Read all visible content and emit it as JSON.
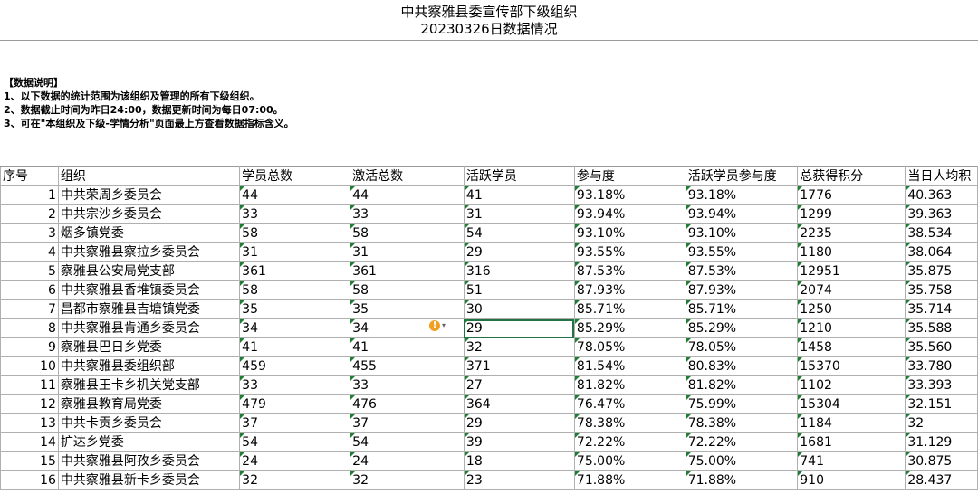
{
  "header": {
    "title": "中共察雅县委宣传部下级组织",
    "subtitle": "20230326日数据情况"
  },
  "notes": {
    "heading": "【数据说明】",
    "lines": [
      "1、以下数据的统计范围为该组织及管理的所有下级组织。",
      "2、数据截止时间为昨日24:00，数据更新时间为每日07:00。",
      "3、可在\"本组织及下级-学情分析\"页面最上方查看数据指标含义。"
    ]
  },
  "table": {
    "columns": [
      "序号",
      "组织",
      "学员总数",
      "激活总数",
      "活跃学员",
      "参与度",
      "活跃学员参与度",
      "总获得积分",
      "当日人均积"
    ],
    "rows": [
      {
        "idx": "1",
        "org": "中共荣周乡委员会",
        "total": "44",
        "activated": "44",
        "active": "41",
        "participation": "93.18%",
        "active_participation": "93.18%",
        "points": "1776",
        "avg": "40.363"
      },
      {
        "idx": "2",
        "org": "中共宗沙乡委员会",
        "total": "33",
        "activated": "33",
        "active": "31",
        "participation": "93.94%",
        "active_participation": "93.94%",
        "points": "1299",
        "avg": "39.363"
      },
      {
        "idx": "3",
        "org": "烟多镇党委",
        "total": "58",
        "activated": "58",
        "active": "54",
        "participation": "93.10%",
        "active_participation": "93.10%",
        "points": "2235",
        "avg": "38.534"
      },
      {
        "idx": "4",
        "org": "中共察雅县察拉乡委员会",
        "total": "31",
        "activated": "31",
        "active": "29",
        "participation": "93.55%",
        "active_participation": "93.55%",
        "points": "1180",
        "avg": "38.064"
      },
      {
        "idx": "5",
        "org": "察雅县公安局党支部",
        "total": "361",
        "activated": "361",
        "active": "316",
        "participation": "87.53%",
        "active_participation": "87.53%",
        "points": "12951",
        "avg": "35.875"
      },
      {
        "idx": "6",
        "org": "中共察雅县香堆镇委员会",
        "total": "58",
        "activated": "58",
        "active": "51",
        "participation": "87.93%",
        "active_participation": "87.93%",
        "points": "2074",
        "avg": "35.758"
      },
      {
        "idx": "7",
        "org": "昌都市察雅县吉塘镇党委",
        "total": "35",
        "activated": "35",
        "active": "30",
        "participation": "85.71%",
        "active_participation": "85.71%",
        "points": "1250",
        "avg": "35.714"
      },
      {
        "idx": "8",
        "org": "中共察雅县肯通乡委员会",
        "total": "34",
        "activated": "34",
        "active": "29",
        "participation": "85.29%",
        "active_participation": "85.29%",
        "points": "1210",
        "avg": "35.588"
      },
      {
        "idx": "9",
        "org": "察雅县巴日乡党委",
        "total": "41",
        "activated": "41",
        "active": "32",
        "participation": "78.05%",
        "active_participation": "78.05%",
        "points": "1458",
        "avg": "35.560"
      },
      {
        "idx": "10",
        "org": "中共察雅县委组织部",
        "total": "459",
        "activated": "455",
        "active": "371",
        "participation": "81.54%",
        "active_participation": "80.83%",
        "points": "15370",
        "avg": "33.780"
      },
      {
        "idx": "11",
        "org": "察雅县王卡乡机关党支部",
        "total": "33",
        "activated": "33",
        "active": "27",
        "participation": "81.82%",
        "active_participation": "81.82%",
        "points": "1102",
        "avg": "33.393"
      },
      {
        "idx": "12",
        "org": "察雅县教育局党委",
        "total": "479",
        "activated": "476",
        "active": "364",
        "participation": "76.47%",
        "active_participation": "75.99%",
        "points": "15304",
        "avg": "32.151"
      },
      {
        "idx": "13",
        "org": "中共卡贡乡委员会",
        "total": "37",
        "activated": "37",
        "active": "29",
        "participation": "78.38%",
        "active_participation": "78.38%",
        "points": "1184",
        "avg": "32"
      },
      {
        "idx": "14",
        "org": "扩达乡党委",
        "total": "54",
        "activated": "54",
        "active": "39",
        "participation": "72.22%",
        "active_participation": "72.22%",
        "points": "1681",
        "avg": "31.129"
      },
      {
        "idx": "15",
        "org": "中共察雅县阿孜乡委员会",
        "total": "24",
        "activated": "24",
        "active": "18",
        "participation": "75.00%",
        "active_participation": "75.00%",
        "points": "741",
        "avg": "30.875"
      },
      {
        "idx": "16",
        "org": "中共察雅县新卡乡委员会",
        "total": "32",
        "activated": "32",
        "active": "23",
        "participation": "71.88%",
        "active_participation": "71.88%",
        "points": "910",
        "avg": "28.437"
      }
    ]
  },
  "selected_cell": {
    "row": 7,
    "column": "active"
  },
  "icons": {
    "warning": "warning-icon"
  },
  "colors": {
    "selection_border": "#217346",
    "number_marker": "#1e7e34",
    "warning": "#f0a020"
  }
}
